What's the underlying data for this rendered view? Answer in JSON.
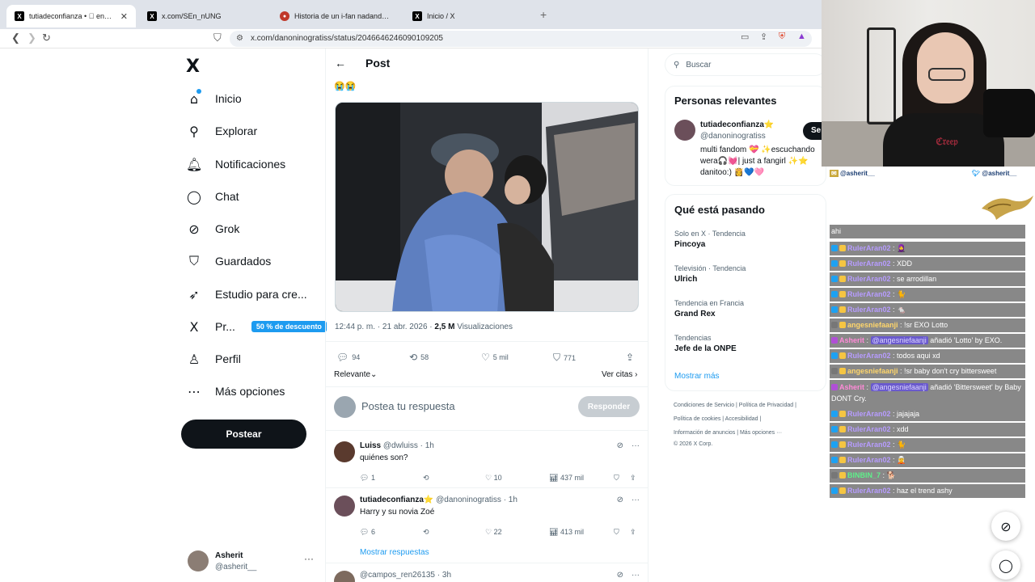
{
  "browser": {
    "tabs": [
      {
        "title": "tutiadeconfianza • ⃞ en X: \"MÁTE",
        "icon": "x-logo-icon",
        "active": true
      },
      {
        "title": "x.com/SEn_nUNG",
        "icon": "x-logo-icon",
        "active": false
      },
      {
        "title": "Historia de un i-fan nadando en un",
        "icon": "red-site-icon",
        "active": false
      },
      {
        "title": "Inicio / X",
        "icon": "x-logo-icon",
        "active": false
      }
    ],
    "url": "x.com/danoninogratiss/status/2046646246090109205"
  },
  "sidebar": {
    "logo": "X",
    "items": [
      {
        "label": "Inicio",
        "icon": "home-icon",
        "glyph": "⌂"
      },
      {
        "label": "Explorar",
        "icon": "search-icon",
        "glyph": "⚲"
      },
      {
        "label": "Notificaciones",
        "icon": "bell-icon",
        "glyph": "🔔︎"
      },
      {
        "label": "Chat",
        "icon": "chat-icon",
        "glyph": "◯"
      },
      {
        "label": "Grok",
        "icon": "grok-icon",
        "glyph": "⊘"
      },
      {
        "label": "Guardados",
        "icon": "bookmark-icon",
        "glyph": "⛉"
      },
      {
        "label": "Estudio para cre...",
        "icon": "rocket-icon",
        "glyph": "➶"
      },
      {
        "label": "Pr...",
        "icon": "x-premium-icon",
        "glyph": "X"
      },
      {
        "label": "Perfil",
        "icon": "person-icon",
        "glyph": "♙"
      },
      {
        "label": "Más opciones",
        "icon": "more-circle-icon",
        "glyph": "⋯"
      }
    ],
    "premium_badge": "50 % de descuento",
    "post_button": "Postear",
    "user": {
      "name": "Asherit",
      "handle": "@asherit__",
      "more": "···"
    }
  },
  "post": {
    "header": "Post",
    "emojis": "😭😭",
    "time": "12:44 p. m. · 21 abr. 2026 ·",
    "views_count": "2,5 M",
    "views_label": "Visualizaciones",
    "stats": {
      "replies": "94",
      "reposts": "58",
      "likes": "5 mil",
      "bookmarks": "771"
    },
    "sort_label": "Relevante",
    "quotes_label": "Ver citas",
    "reply_placeholder": "Postea tu respuesta",
    "reply_button": "Responder"
  },
  "replies": [
    {
      "name": "Luiss",
      "handle": "@dwluiss",
      "time": "· 1h",
      "text": "quiénes son?",
      "replies": "1",
      "likes": "10",
      "views": "437 mil",
      "avatar_color": "#5a3a2e"
    },
    {
      "name": "tutiadeconfianza⭐",
      "handle": "@danoninogratiss",
      "time": "· 1h",
      "text": "Harry y su novia Zoé",
      "replies": "6",
      "likes": "22",
      "views": "413 mil",
      "avatar_color": "#6b4f5a"
    },
    {
      "name": "",
      "handle": "@campos_ren26135",
      "time": "· 3h",
      "text": "",
      "replies": "",
      "likes": "",
      "views": "",
      "avatar_color": "#7d6a5e"
    }
  ],
  "show_replies": "Mostrar respuestas",
  "right": {
    "search_placeholder": "Buscar",
    "relevant": {
      "title": "Personas relevantes",
      "name": "tutiadeconfianza⭐",
      "handle": "@danoninogratiss",
      "bio": "multi fandom 💝 ✨escuchando wera🎧💓| just a fangirl ✨⭐ danitoo:) 👸💙🩷",
      "follow": "Se"
    },
    "trends_title": "Qué está pasando",
    "trends": [
      {
        "category": "Solo en X · Tendencia",
        "name": "Pincoya"
      },
      {
        "category": "Televisión · Tendencia",
        "name": "Ulrich"
      },
      {
        "category": "Tendencia en Francia",
        "name": "Grand Rex"
      },
      {
        "category": "Tendencias",
        "name": "Jefe de la ONPE"
      }
    ],
    "show_more": "Mostrar más",
    "footer": [
      "Condiciones de Servicio  |  Política de Privacidad  |",
      "Política de cookies  |  Accesibilidad  |",
      "Información de anuncios  |  Más opciones ···",
      "© 2026 X Corp."
    ]
  },
  "stream": {
    "social_left": "@asherit__",
    "social_right": "@asherit__",
    "shirt_print": "ℭ𝔯𝔢𝔢𝔭",
    "chat": [
      {
        "user": "",
        "text": "ahi"
      },
      {
        "user": "RulerAran02",
        "text": ": 🧕"
      },
      {
        "user": "RulerAran02",
        "text": ": XDD"
      },
      {
        "user": "RulerAran02",
        "text": ": se arrodillan"
      },
      {
        "user": "RulerAran02",
        "text": ": 🐈"
      },
      {
        "user": "RulerAran02",
        "text": ": 🐁"
      },
      {
        "user": "angesniefaanji",
        "text": ": !sr EXO Lotto"
      },
      {
        "user": "Asherit",
        "mention": "@angesniefaanji",
        "text": "añadió 'Lotto' by EXO."
      },
      {
        "user": "RulerAran02",
        "mention": "@angesniefaanji",
        "text": ": todos aqui xd"
      },
      {
        "user": "angesniefaanji",
        "text": ": !sr baby don't cry bittersweet"
      },
      {
        "user": "Asherit",
        "mention": "@angesniefaanji",
        "text": "añadió 'Bittersweet' by Baby DONT Cry."
      },
      {
        "user": "RulerAran02",
        "text": ": jajajaja"
      },
      {
        "user": "RulerAran02",
        "text": ": xdd"
      },
      {
        "user": "RulerAran02",
        "text": ": 🐈"
      },
      {
        "user": "RulerAran02",
        "text": ": 🧝"
      },
      {
        "user": "BINBIN_7",
        "text": ": 🐕"
      },
      {
        "user": "RulerAran02",
        "text": ": haz el trend ashy"
      }
    ]
  }
}
